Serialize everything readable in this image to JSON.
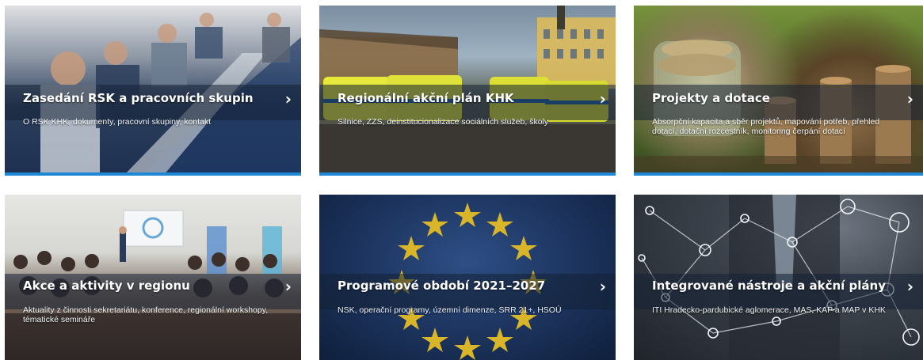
{
  "colors": {
    "accent_blue": "#1e88d6",
    "band": "#142034"
  },
  "cards": [
    {
      "title": "Zasedání RSK a pracovních skupin",
      "description": "O RSK KHK, dokumenty, pracovní skupiny, kontakt",
      "icon": "chevron-right-icon"
    },
    {
      "title": "Regionální akční plán KHK",
      "description": "Silnice, ZZS, deinstitucionalizace sociálních služeb, školy",
      "icon": "chevron-right-icon"
    },
    {
      "title": "Projekty a dotace",
      "description": "Absorpční kapacita a sběr projektů, mapování potřeb, přehled dotací, dotační rozcestník, monitoring čerpání dotací",
      "icon": "chevron-right-icon"
    },
    {
      "title": "Akce a aktivity v regionu",
      "description": "Aktuality z činnosti sekretariátu, konference, regionální workshopy, tématické semináře",
      "icon": "chevron-right-icon"
    },
    {
      "title": "Programové období 2021–2027",
      "description": "NSK, operační programy, územní dimenze, SRR 21+, HSOÚ",
      "icon": "chevron-right-icon"
    },
    {
      "title": "Integrované nástroje a akční plány",
      "description": "ITI Hradecko-pardubické aglomerace, MAS, KAP a MAP v KHK",
      "icon": "chevron-right-icon"
    }
  ],
  "chevron_glyph": "›"
}
